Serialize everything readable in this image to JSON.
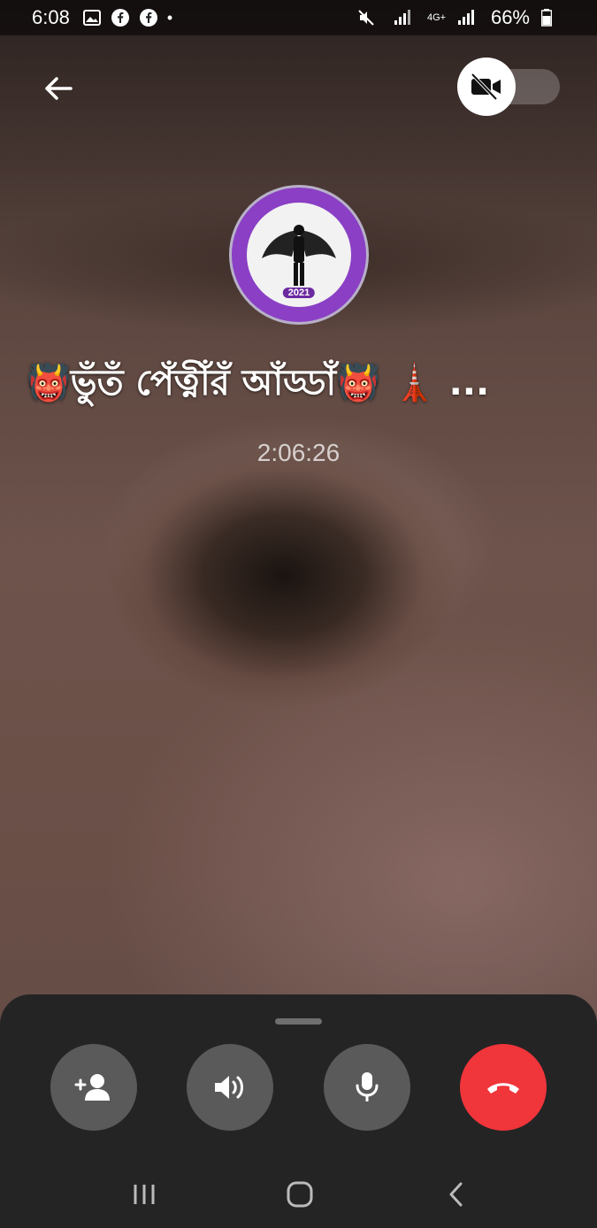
{
  "status_bar": {
    "time": "6:08",
    "dot": "•",
    "battery": "66%",
    "network": "4G+",
    "icons": [
      "image-icon",
      "facebook-icon",
      "facebook-icon",
      "mute-icon",
      "signal-icon",
      "network-icon",
      "signal-icon",
      "battery-icon"
    ]
  },
  "header": {
    "back_icon": "arrow-left-icon",
    "video_toggle_icon": "video-off-icon"
  },
  "call": {
    "avatar_text": "2021",
    "name": "👹ভুঁতঁ পেঁত্নীঁরঁ আঁড্ডাঁ👹 🗼 ...",
    "duration": "2:06:26"
  },
  "controls": [
    {
      "name": "add-person-button",
      "icon": "add-person-icon"
    },
    {
      "name": "speaker-button",
      "icon": "speaker-icon"
    },
    {
      "name": "mic-button",
      "icon": "mic-icon"
    },
    {
      "name": "end-call-button",
      "icon": "phone-hangup-icon",
      "color": "#f0353b"
    }
  ],
  "colors": {
    "panel": "#242424",
    "button": "#5a5a5a",
    "end_call": "#f0353b"
  }
}
